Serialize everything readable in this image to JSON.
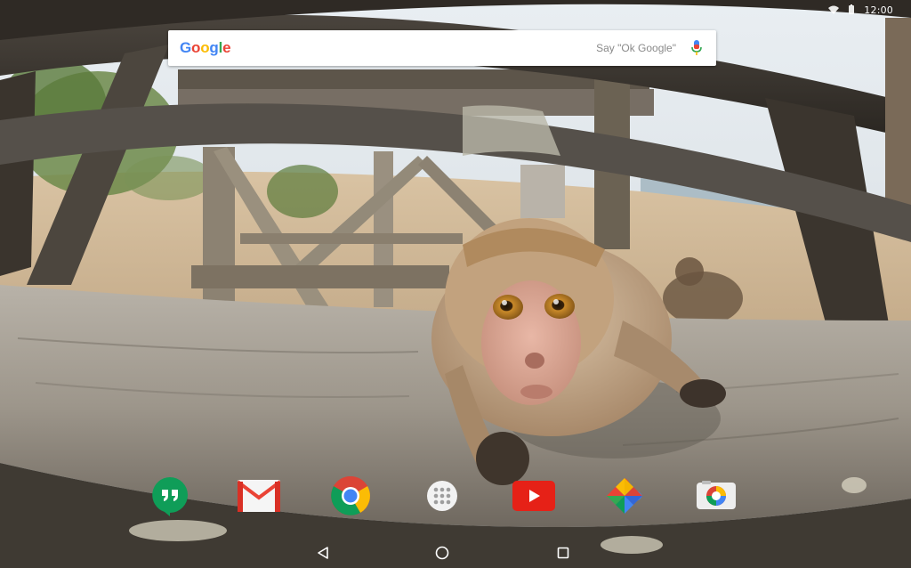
{
  "status_bar": {
    "icons": [
      "wifi-icon",
      "battery-icon"
    ],
    "time": "12:00"
  },
  "search": {
    "logo_letters": [
      "G",
      "o",
      "o",
      "g",
      "l",
      "e"
    ],
    "logo_colors": [
      "#4285F4",
      "#EA4335",
      "#FBBC05",
      "#4285F4",
      "#34A853",
      "#EA4335"
    ],
    "hint": "Say \"Ok Google\"",
    "mic_icon": "mic-icon"
  },
  "dock": {
    "apps": [
      {
        "icon": "hangouts-icon",
        "color": "#0F9D58"
      },
      {
        "icon": "gmail-icon",
        "color": "#EA4335"
      },
      {
        "icon": "chrome-icon",
        "color": "#4285F4"
      },
      {
        "icon": "app-drawer-icon",
        "color": "#FFFFFF"
      },
      {
        "icon": "youtube-icon",
        "color": "#FF0000"
      },
      {
        "icon": "photos-icon",
        "color": "#FBBC05"
      },
      {
        "icon": "camera-icon",
        "color": "#DB4437"
      }
    ]
  },
  "nav_bar": {
    "buttons": [
      "back-icon",
      "home-icon",
      "recents-icon"
    ]
  }
}
